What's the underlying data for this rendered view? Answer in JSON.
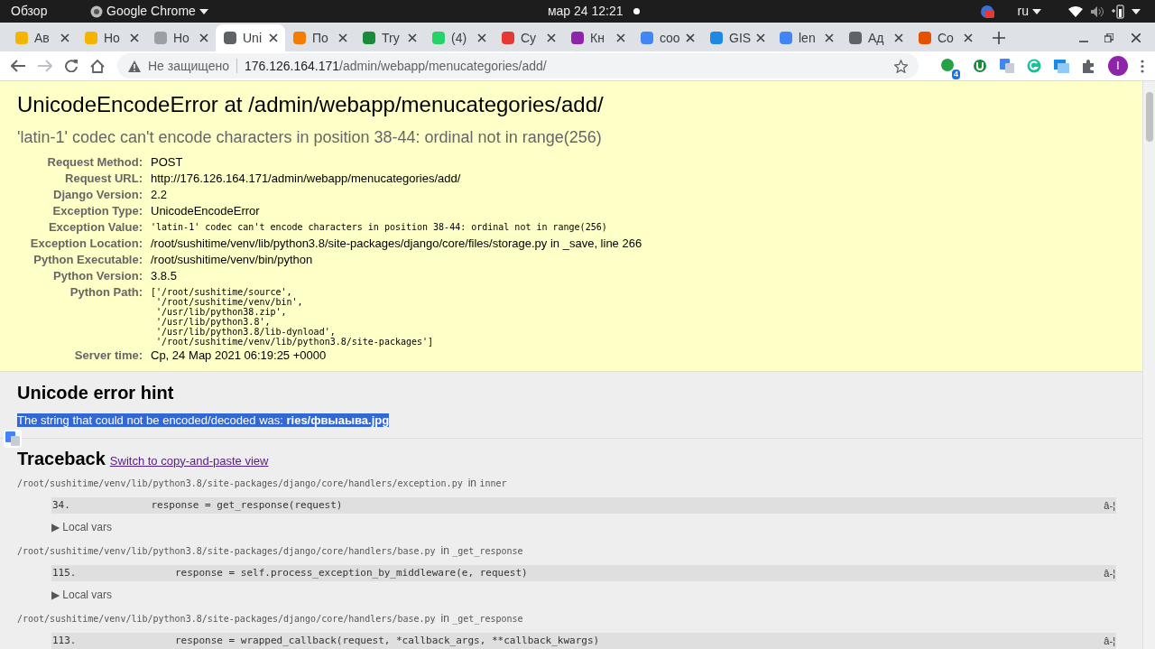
{
  "system_bar": {
    "activities": "Обзор",
    "app": "Google Chrome",
    "clock": "мар 24  12:21",
    "language": "ru"
  },
  "tabs": [
    {
      "title": "Ав",
      "selected": false,
      "color": "#f5b400"
    },
    {
      "title": "Но",
      "selected": false,
      "color": "#f5b400"
    },
    {
      "title": "Но",
      "selected": false,
      "color": "#9aa0a6"
    },
    {
      "title": "Uni",
      "selected": true,
      "color": "#5f6368"
    },
    {
      "title": "По",
      "selected": false,
      "color": "#f57c00"
    },
    {
      "title": "Try",
      "selected": false,
      "color": "#1b8a3a"
    },
    {
      "title": "(4)",
      "selected": false,
      "color": "#25d366"
    },
    {
      "title": "Су",
      "selected": false,
      "color": "#e53935"
    },
    {
      "title": "Кн",
      "selected": false,
      "color": "#8e24aa"
    },
    {
      "title": "coo",
      "selected": false,
      "color": "#4285f4"
    },
    {
      "title": "GIS",
      "selected": false,
      "color": "#1e88e5"
    },
    {
      "title": "len",
      "selected": false,
      "color": "#4285f4"
    },
    {
      "title": "Ад",
      "selected": false,
      "color": "#5f6368"
    },
    {
      "title": "Co",
      "selected": false,
      "color": "#e65100"
    }
  ],
  "address_bar": {
    "security": "Не защищено",
    "host": "176.126.164.171",
    "path": "/admin/webapp/menucategories/add/"
  },
  "extension_badge": "4",
  "profile_initial": "I",
  "summary": {
    "title": "UnicodeEncodeError at /admin/webapp/menucategories/add/",
    "subtitle": "'latin-1' codec can't encode characters in position 38-44: ordinal not in range(256)",
    "meta": [
      {
        "label": "Request Method:",
        "kind": "text",
        "value": "POST"
      },
      {
        "label": "Request URL:",
        "kind": "text",
        "value": "http://176.126.164.171/admin/webapp/menucategories/add/"
      },
      {
        "label": "Django Version:",
        "kind": "text",
        "value": "2.2"
      },
      {
        "label": "Exception Type:",
        "kind": "text",
        "value": "UnicodeEncodeError"
      },
      {
        "label": "Exception Value:",
        "kind": "code",
        "value": "'latin-1' codec can't encode characters in position 38-44: ordinal not in range(256)"
      },
      {
        "label": "Exception Location:",
        "kind": "text",
        "value": "/root/sushitime/venv/lib/python3.8/site-packages/django/core/files/storage.py in _save, line 266"
      },
      {
        "label": "Python Executable:",
        "kind": "text",
        "value": "/root/sushitime/venv/bin/python"
      },
      {
        "label": "Python Version:",
        "kind": "text",
        "value": "3.8.5"
      },
      {
        "label": "Python Path:",
        "kind": "code",
        "value": "['/root/sushitime/source',\n '/root/sushitime/venv/bin',\n '/usr/lib/python38.zip',\n '/usr/lib/python3.8',\n '/usr/lib/python3.8/lib-dynload',\n '/root/sushitime/venv/lib/python3.8/site-packages']"
      },
      {
        "label": "Server time:",
        "kind": "text",
        "value": "Ср, 24 Мар 2021 06:19:25 +0000"
      }
    ]
  },
  "hint": {
    "title": "Unicode error hint",
    "text": "The string that could not be encoded/decoded was: **ries/фвыаыва.jpg**",
    "selected": true
  },
  "traceback": {
    "title": "Traceback",
    "link": "Switch to copy-and-paste view",
    "frames": [
      {
        "file": "/root/sushitime/venv/lib/python3.8/site-packages/django/core/handlers/exception.py",
        "in": "in",
        "function": "inner",
        "line_number": "34.",
        "code": "            response = get_response(request)",
        "toggle": "â-¦",
        "marker": "▶",
        "local_vars": "Local vars"
      },
      {
        "file": "/root/sushitime/venv/lib/python3.8/site-packages/django/core/handlers/base.py",
        "in": "in",
        "function": "_get_response",
        "line_number": "115.",
        "code": "                response = self.process_exception_by_middleware(e, request)",
        "toggle": "â-¦",
        "marker": "▶",
        "local_vars": "Local vars"
      },
      {
        "file": "/root/sushitime/venv/lib/python3.8/site-packages/django/core/handlers/base.py",
        "in": "in",
        "function": "_get_response",
        "line_number": "113.",
        "code": "                response = wrapped_callback(request, *callback_args, **callback_kwargs)",
        "toggle": "â-¦"
      }
    ]
  }
}
